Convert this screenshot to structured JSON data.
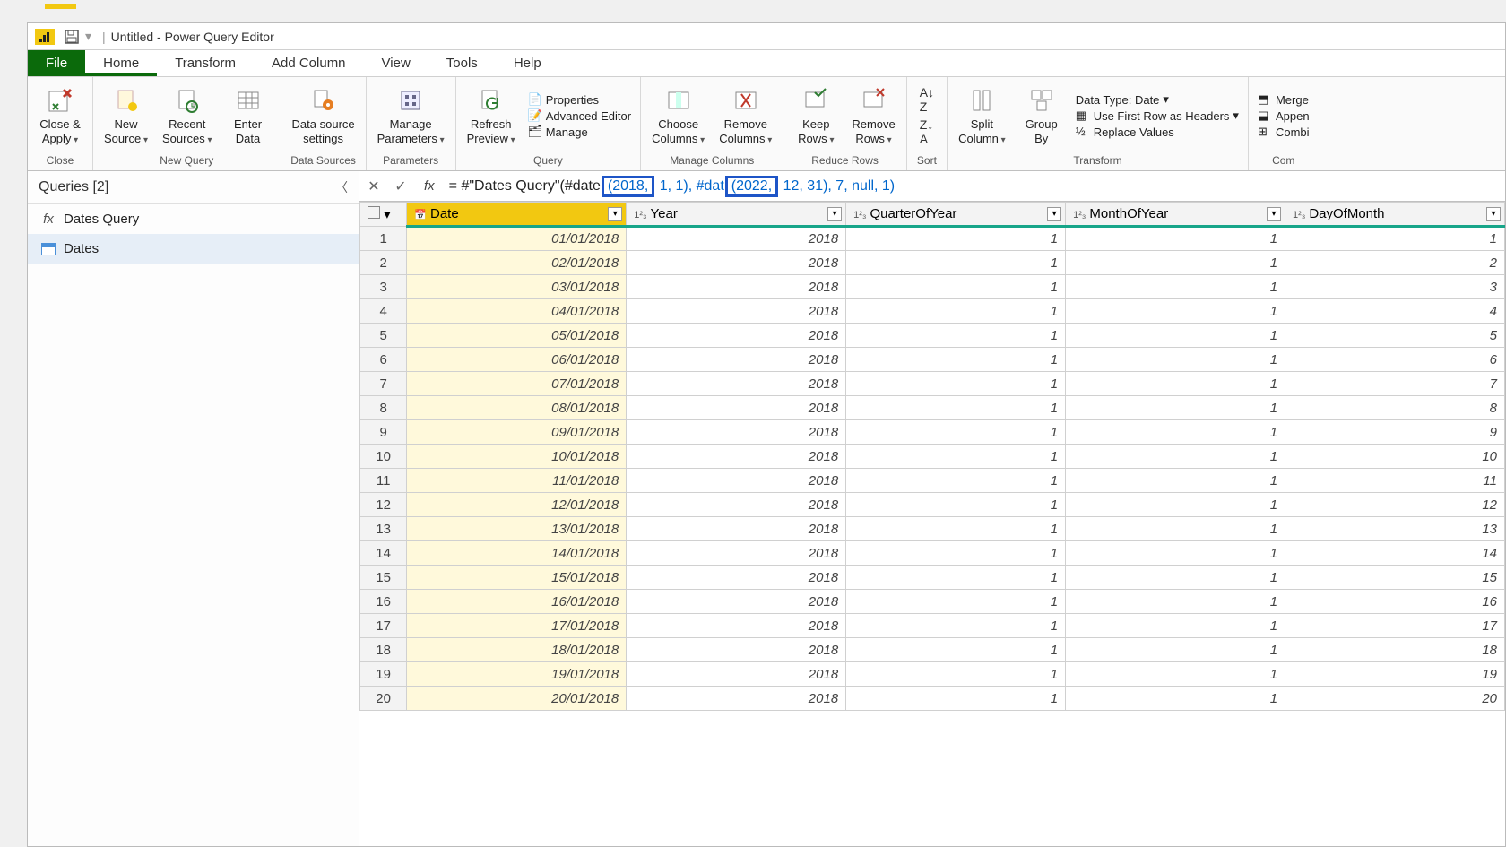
{
  "title": "Untitled - Power Query Editor",
  "menu": {
    "file": "File",
    "home": "Home",
    "transform": "Transform",
    "addcol": "Add Column",
    "view": "View",
    "tools": "Tools",
    "help": "Help"
  },
  "ribbon": {
    "close": {
      "btn": "Close &\nApply",
      "group": "Close"
    },
    "newquery": {
      "new": "New\nSource",
      "recent": "Recent\nSources",
      "enter": "Enter\nData",
      "group": "New Query"
    },
    "datasources": {
      "btn": "Data source\nsettings",
      "group": "Data Sources"
    },
    "params": {
      "btn": "Manage\nParameters",
      "group": "Parameters"
    },
    "query": {
      "refresh": "Refresh\nPreview",
      "props": "Properties",
      "adv": "Advanced Editor",
      "manage": "Manage",
      "group": "Query"
    },
    "managecols": {
      "choose": "Choose\nColumns",
      "remove": "Remove\nColumns",
      "group": "Manage Columns"
    },
    "reducerows": {
      "keep": "Keep\nRows",
      "remove": "Remove\nRows",
      "group": "Reduce Rows"
    },
    "sort": {
      "group": "Sort"
    },
    "transform": {
      "split": "Split\nColumn",
      "group": "Group\nBy",
      "dt": "Data Type: Date",
      "first": "Use First Row as Headers",
      "replace": "Replace Values",
      "grp": "Transform"
    },
    "combine": {
      "merge": "Merge",
      "append": "Appen",
      "combine": "Combi",
      "grp": "Com"
    }
  },
  "queries": {
    "title": "Queries [2]",
    "fn": "Dates Query",
    "tbl": "Dates"
  },
  "formula": {
    "pre": "= #\"Dates Query\"(#date",
    "h1": "(2018,",
    "mid1": " 1, 1), #dat",
    "h2": "(2022,",
    "mid2": " 12, 31), 7, null, 1)"
  },
  "columns": [
    "Date",
    "Year",
    "QuarterOfYear",
    "MonthOfYear",
    "DayOfMonth"
  ],
  "rows": [
    {
      "n": 1,
      "d": "01/01/2018",
      "y": "2018",
      "q": "1",
      "m": "1",
      "day": "1"
    },
    {
      "n": 2,
      "d": "02/01/2018",
      "y": "2018",
      "q": "1",
      "m": "1",
      "day": "2"
    },
    {
      "n": 3,
      "d": "03/01/2018",
      "y": "2018",
      "q": "1",
      "m": "1",
      "day": "3"
    },
    {
      "n": 4,
      "d": "04/01/2018",
      "y": "2018",
      "q": "1",
      "m": "1",
      "day": "4"
    },
    {
      "n": 5,
      "d": "05/01/2018",
      "y": "2018",
      "q": "1",
      "m": "1",
      "day": "5"
    },
    {
      "n": 6,
      "d": "06/01/2018",
      "y": "2018",
      "q": "1",
      "m": "1",
      "day": "6"
    },
    {
      "n": 7,
      "d": "07/01/2018",
      "y": "2018",
      "q": "1",
      "m": "1",
      "day": "7"
    },
    {
      "n": 8,
      "d": "08/01/2018",
      "y": "2018",
      "q": "1",
      "m": "1",
      "day": "8"
    },
    {
      "n": 9,
      "d": "09/01/2018",
      "y": "2018",
      "q": "1",
      "m": "1",
      "day": "9"
    },
    {
      "n": 10,
      "d": "10/01/2018",
      "y": "2018",
      "q": "1",
      "m": "1",
      "day": "10"
    },
    {
      "n": 11,
      "d": "11/01/2018",
      "y": "2018",
      "q": "1",
      "m": "1",
      "day": "11"
    },
    {
      "n": 12,
      "d": "12/01/2018",
      "y": "2018",
      "q": "1",
      "m": "1",
      "day": "12"
    },
    {
      "n": 13,
      "d": "13/01/2018",
      "y": "2018",
      "q": "1",
      "m": "1",
      "day": "13"
    },
    {
      "n": 14,
      "d": "14/01/2018",
      "y": "2018",
      "q": "1",
      "m": "1",
      "day": "14"
    },
    {
      "n": 15,
      "d": "15/01/2018",
      "y": "2018",
      "q": "1",
      "m": "1",
      "day": "15"
    },
    {
      "n": 16,
      "d": "16/01/2018",
      "y": "2018",
      "q": "1",
      "m": "1",
      "day": "16"
    },
    {
      "n": 17,
      "d": "17/01/2018",
      "y": "2018",
      "q": "1",
      "m": "1",
      "day": "17"
    },
    {
      "n": 18,
      "d": "18/01/2018",
      "y": "2018",
      "q": "1",
      "m": "1",
      "day": "18"
    },
    {
      "n": 19,
      "d": "19/01/2018",
      "y": "2018",
      "q": "1",
      "m": "1",
      "day": "19"
    },
    {
      "n": 20,
      "d": "20/01/2018",
      "y": "2018",
      "q": "1",
      "m": "1",
      "day": "20"
    }
  ]
}
